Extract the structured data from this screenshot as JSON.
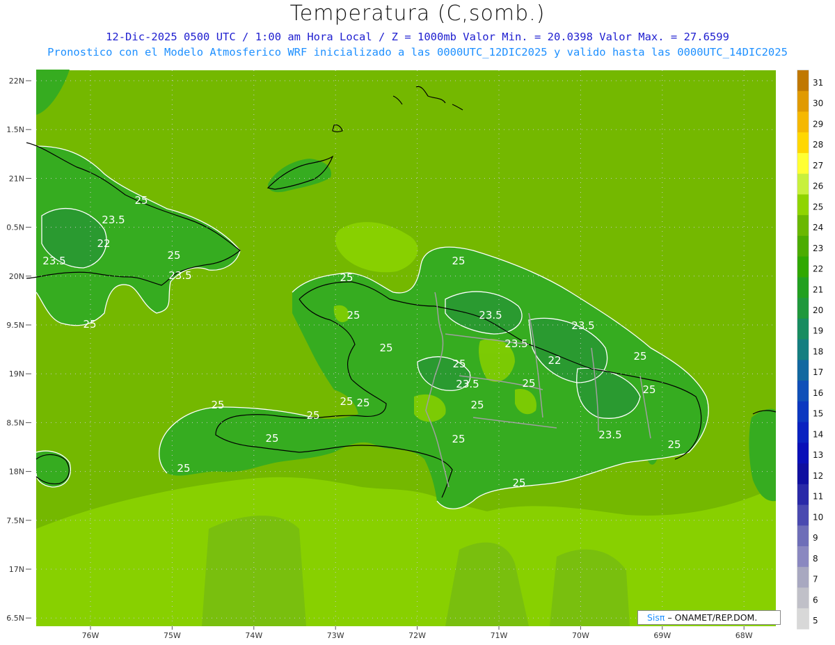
{
  "header": {
    "title": "Temperatura (C,somb.)",
    "line1": "12-Dic-2025  0500 UTC / 1:00 am Hora Local / Z = 1000mb   Valor Min. = 20.0398  Valor Max. = 27.6599",
    "line2": "Pronostico con el Modelo Atmosferico WRF inicializado a las 0000UTC_12DIC2025 y valido hasta las  0000UTC_14DIC2025"
  },
  "axes": {
    "lat_labels": [
      "22N",
      "1.5N",
      "21N",
      "0.5N",
      "20N",
      "9.5N",
      "19N",
      "8.5N",
      "18N",
      "7.5N",
      "17N",
      "6.5N"
    ],
    "lon_labels": [
      "76W",
      "75W",
      "74W",
      "73W",
      "72W",
      "71W",
      "70W",
      "69W",
      "68W"
    ]
  },
  "contour_labels": [
    "25",
    "23.5",
    "22",
    "23.5",
    "25",
    "23.5",
    "25",
    "25",
    "25",
    "25",
    "25",
    "23.5",
    "23.5",
    "23.5",
    "25",
    "22",
    "25",
    "23.5",
    "25",
    "25",
    "25",
    "25",
    "25",
    "25",
    "25",
    "25",
    "23.5",
    "25",
    "25",
    "25"
  ],
  "colorbar": {
    "labels": [
      "31",
      "30",
      "29",
      "28",
      "27",
      "26",
      "25",
      "24",
      "23",
      "22",
      "21",
      "20",
      "19",
      "18",
      "17",
      "16",
      "15",
      "14",
      "13",
      "12",
      "11",
      "10",
      "9",
      "8",
      "7",
      "6",
      "5"
    ],
    "colors": [
      "#c07800",
      "#e09a00",
      "#f5b800",
      "#ffd700",
      "#ffff33",
      "#c8f03c",
      "#8fd400",
      "#6ab800",
      "#4cac00",
      "#30a800",
      "#22a020",
      "#20983c",
      "#188c60",
      "#157e80",
      "#1268a0",
      "#1050b8",
      "#0c38c0",
      "#0a22c0",
      "#0a10b8",
      "#1010a0",
      "#2a2aa8",
      "#4a4ab0",
      "#6e6eb8",
      "#8a88c0",
      "#a8a8c0",
      "#c0c0c8",
      "#d8d8d8"
    ]
  },
  "credit": {
    "brand": "Sisπ",
    "text": "– ONAMET/REP.DOM."
  },
  "colors": {
    "sea_green": "#74b800",
    "land_green": "#36ac20",
    "warm_sea": "#88d000",
    "dark_land": "#2a9a30",
    "title_blue": "#2020d0",
    "subtitle_blue": "#1e90ff"
  }
}
